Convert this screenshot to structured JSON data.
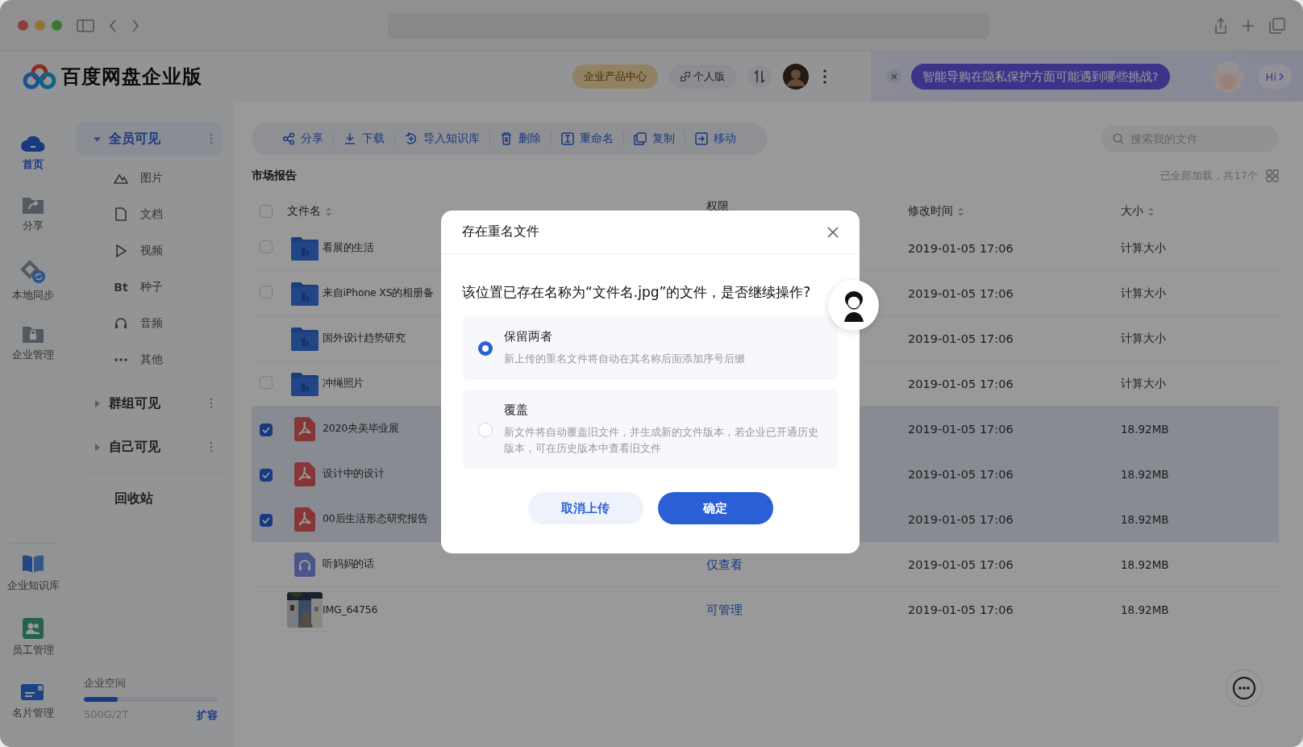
{
  "header": {
    "title": "百度网盘企业版",
    "buttons": [
      {
        "label": "企业产品中心",
        "kind": "gold"
      },
      {
        "label": "个人版",
        "kind": "link"
      }
    ],
    "ai_banner": {
      "prompt": "智能导购在隐私保护方面可能遇到哪些挑战?",
      "greeting": "Hi"
    }
  },
  "nav_rail": {
    "top": [
      {
        "label": "首页",
        "kind": "home",
        "selected": true
      },
      {
        "label": "分享",
        "kind": "share",
        "selected": false
      },
      {
        "label": "本地同步",
        "kind": "sync",
        "selected": false
      },
      {
        "label": "企业管理",
        "kind": "lock",
        "selected": false
      }
    ],
    "bottom": [
      {
        "label": "企业知识库",
        "kind": "book",
        "selected": false
      },
      {
        "label": "员工管理",
        "kind": "staff",
        "selected": false
      },
      {
        "label": "名片管理",
        "kind": "card",
        "selected": false
      }
    ]
  },
  "sidebar": {
    "groups": [
      {
        "label": "全员可见",
        "expanded": true,
        "selected": true,
        "children": [
          {
            "label": "图片"
          },
          {
            "label": "文档",
            "kind": "doc"
          },
          {
            "label": "视频",
            "kind": "video"
          },
          {
            "label": "种子",
            "kind": "torrent",
            "glyph": "Bt"
          },
          {
            "label": "音频",
            "kind": "audio"
          },
          {
            "label": "其他",
            "kind": "other"
          }
        ]
      },
      {
        "label": "群组可见",
        "expanded": false,
        "selected": false
      },
      {
        "label": "自己可见",
        "expanded": false,
        "selected": false
      }
    ],
    "recycle": "回收站",
    "storage": {
      "label": "企业空间",
      "level": 0.25,
      "usage": "500G/2T",
      "action": "扩容"
    }
  },
  "toolbar": {
    "actions": [
      {
        "label": "分享",
        "kind": "share"
      },
      {
        "label": "下载",
        "kind": "download"
      },
      {
        "label": "导入知识库",
        "kind": "import"
      },
      {
        "label": "删除",
        "kind": "delete"
      },
      {
        "label": "重命名",
        "kind": "rename"
      },
      {
        "label": "复制",
        "kind": "copy"
      },
      {
        "label": "移动",
        "kind": "move"
      }
    ],
    "search": {
      "placeholder": "搜索我的文件"
    }
  },
  "breadcrumb": "市场报告",
  "status": "已全部加载，共17个",
  "table": {
    "select_all": {
      "checked": false
    },
    "columns": [
      {
        "label": "文件名",
        "sortable": true
      },
      {
        "label": "权限",
        "sortable": false
      },
      {
        "label": "修改时间",
        "sortable": true
      },
      {
        "label": "大小",
        "sortable": true
      }
    ],
    "rows": [
      {
        "name": "看展的生活",
        "kind": "folder",
        "checked": false,
        "modified": "2019-01-05 17:06",
        "size": "计算大小"
      },
      {
        "name": "来自iPhone XS的相册备",
        "kind": "folder",
        "checked": false,
        "modified": "2019-01-05 17:06",
        "size": "计算大小"
      },
      {
        "name": "国外设计趋势研究",
        "kind": "folder",
        "modified": "2019-01-05 17:06",
        "size": "计算大小"
      },
      {
        "name": "冲绳照片",
        "kind": "folder",
        "checked": false,
        "modified": "2019-01-05 17:06",
        "size": "计算大小"
      },
      {
        "name": "2020央美毕业展",
        "kind": "pdf",
        "checked": true,
        "modified": "2019-01-05 17:06",
        "size": "18.92MB"
      },
      {
        "name": "设计中的设计",
        "kind": "pdf",
        "checked": true,
        "modified": "2019-01-05 17:06",
        "size": "18.92MB"
      },
      {
        "name": "00后生活形态研究报告",
        "kind": "pdf",
        "checked": true,
        "modified": "2019-01-05 17:06",
        "size": "18.92MB"
      },
      {
        "name": "听妈妈的话",
        "kind": "audio",
        "permission": "仅查看",
        "modified": "2019-01-05 17:06",
        "size": "18.92MB"
      },
      {
        "name": "IMG_64756",
        "permission": "可管理",
        "modified": "2019-01-05 17:06",
        "size": "18.92MB"
      }
    ]
  },
  "dialog": {
    "title": "存在重名文件",
    "question": "该位置已存在名称为“文件名.jpg”的文件，是否继续操作?",
    "options": [
      {
        "title": "保留两者",
        "description": "新上传的重名文件将自动在其名称后面添加序号后缀",
        "selected": true
      },
      {
        "title": "覆盖",
        "description": "新文件将自动覆盖旧文件，并生成新的文件版本，若企业已开通历史版本，可在历史版本中查看旧文件",
        "selected": false
      }
    ],
    "buttons": [
      {
        "label": "取消上传",
        "kind": "secondary"
      },
      {
        "label": "确定",
        "kind": "primary"
      }
    ]
  }
}
